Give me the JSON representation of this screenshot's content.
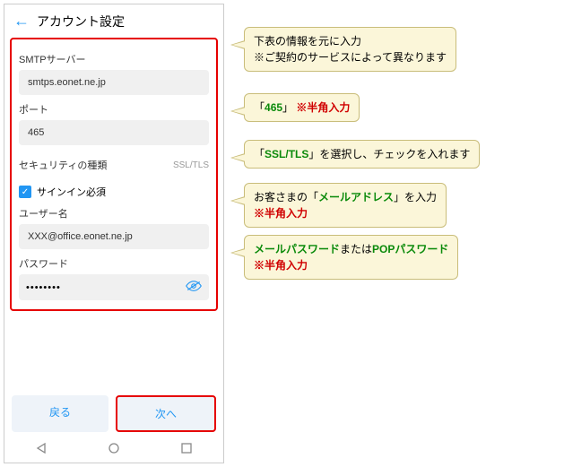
{
  "header": {
    "title": "アカウント設定"
  },
  "form": {
    "smtp_label": "SMTPサーバー",
    "smtp_value": "smtps.eonet.ne.jp",
    "port_label": "ポート",
    "port_value": "465",
    "security_label": "セキュリティの種類",
    "security_value": "SSL/TLS",
    "signin_required": "サインイン必須",
    "username_label": "ユーザー名",
    "username_value": "XXX@office.eonet.ne.jp",
    "password_label": "パスワード",
    "password_value": "••••••••"
  },
  "buttons": {
    "back": "戻る",
    "next": "次へ"
  },
  "callouts": {
    "c1a": "下表の情報を元に入力",
    "c1b": "※ご契約のサービスによって異なります",
    "c2a": "「",
    "c2b": "465",
    "c2c": "」",
    "c2d": "※半角入力",
    "c3a": "「",
    "c3b": "SSL/TLS",
    "c3c": "」を選択し、チェックを入れます",
    "c4a": "お客さまの「",
    "c4b": "メールアドレス",
    "c4c": "」を入力",
    "c4d": "※半角入力",
    "c5a": "メールパスワード",
    "c5b": "または",
    "c5c": "POPパスワード",
    "c5d": "※半角入力"
  }
}
